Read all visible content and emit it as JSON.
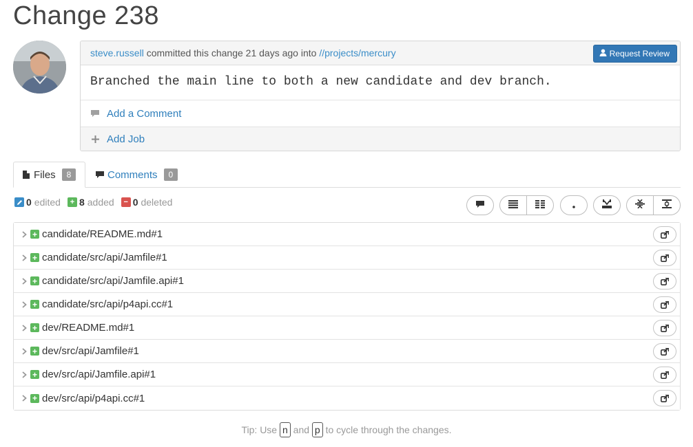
{
  "page_title": "Change 238",
  "change": {
    "author": "steve.russell",
    "committed_text": "committed this change",
    "time_ago": "21 days ago",
    "into_text": "into",
    "project_path": "//projects/mercury",
    "request_review_label": "Request Review",
    "description": "Branched the main line to both a new candidate and dev branch.",
    "add_comment_label": "Add a Comment",
    "add_job_label": "Add Job"
  },
  "tabs": {
    "files_label": "Files",
    "files_count": "8",
    "comments_label": "Comments",
    "comments_count": "0"
  },
  "stats": {
    "edited_count": "0",
    "edited_label": "edited",
    "added_count": "8",
    "added_label": "added",
    "deleted_count": "0",
    "deleted_label": "deleted"
  },
  "files": [
    "candidate/README.md#1",
    "candidate/src/api/Jamfile#1",
    "candidate/src/api/Jamfile.api#1",
    "candidate/src/api/p4api.cc#1",
    "dev/README.md#1",
    "dev/src/api/Jamfile#1",
    "dev/src/api/Jamfile.api#1",
    "dev/src/api/p4api.cc#1"
  ],
  "tip": {
    "prefix": "Tip: Use",
    "key_next": "n",
    "and_text": "and",
    "key_prev": "p",
    "suffix": "to cycle through the changes."
  },
  "colors": {
    "link": "#2f7fbc",
    "primary_button": "#3277b5",
    "added": "#5cb85c",
    "edited": "#3a8dc8",
    "deleted": "#d9534f"
  },
  "icons": {
    "toolbar": [
      "comment-icon",
      "unified-view-icon",
      "side-by-side-view-icon",
      "whitespace-icon",
      "collapse-all-icon",
      "expand-lines-icon",
      "show-full-file-icon"
    ],
    "row": [
      "chevron-right-icon",
      "added-file-icon",
      "open-file-icon"
    ]
  }
}
